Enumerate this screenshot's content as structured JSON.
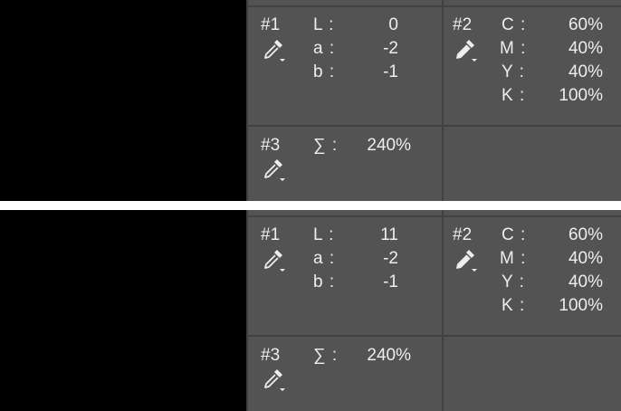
{
  "panels": [
    {
      "sampler1": {
        "id": "#1",
        "icon": "eyedropper-icon",
        "rows": [
          {
            "label": "L :",
            "value": "0"
          },
          {
            "label": "a :",
            "value": "-2"
          },
          {
            "label": "b :",
            "value": "-1"
          }
        ]
      },
      "sampler2": {
        "id": "#2",
        "icon": "eyedropper-icon",
        "rows": [
          {
            "label": "C :",
            "value": "60%"
          },
          {
            "label": "M :",
            "value": "40%"
          },
          {
            "label": "Y :",
            "value": "40%"
          },
          {
            "label": "K :",
            "value": "100%"
          }
        ]
      },
      "sampler3": {
        "id": "#3",
        "icon": "eyedropper-icon",
        "rows": [
          {
            "label": "∑ :",
            "value": "240%"
          }
        ]
      }
    },
    {
      "sampler1": {
        "id": "#1",
        "icon": "eyedropper-icon",
        "rows": [
          {
            "label": "L :",
            "value": "11"
          },
          {
            "label": "a :",
            "value": "-2"
          },
          {
            "label": "b :",
            "value": "-1"
          }
        ]
      },
      "sampler2": {
        "id": "#2",
        "icon": "eyedropper-icon",
        "rows": [
          {
            "label": "C :",
            "value": "60%"
          },
          {
            "label": "M :",
            "value": "40%"
          },
          {
            "label": "Y :",
            "value": "40%"
          },
          {
            "label": "K :",
            "value": "100%"
          }
        ]
      },
      "sampler3": {
        "id": "#3",
        "icon": "eyedropper-icon",
        "rows": [
          {
            "label": "∑ :",
            "value": "240%"
          }
        ]
      }
    }
  ],
  "colors": {
    "canvas": "#000000",
    "panel_bg": "#535353",
    "divider": "#414141",
    "text": "#ededed",
    "separator": "#ffffff"
  }
}
